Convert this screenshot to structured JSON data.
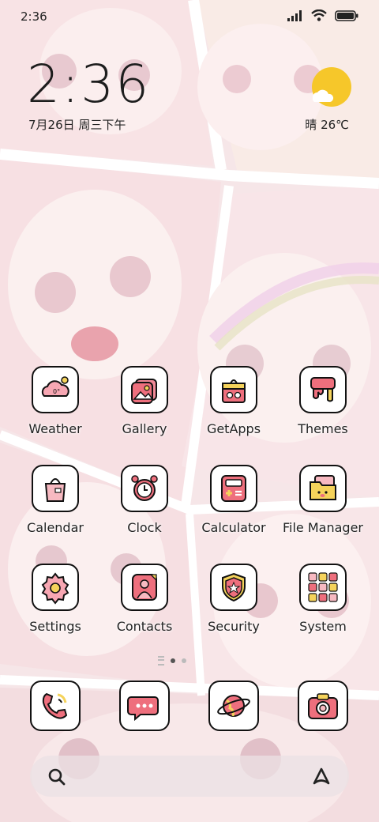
{
  "status_bar": {
    "time": "2:36"
  },
  "clock_widget": {
    "time": "2:36",
    "date": "7月26日 周三下午"
  },
  "weather_widget": {
    "condition": "晴",
    "temperature": "26℃",
    "icon": "sun-cloud-icon"
  },
  "apps": [
    {
      "label": "Weather",
      "icon": "cloud-icon"
    },
    {
      "label": "Gallery",
      "icon": "photo-icon"
    },
    {
      "label": "GetApps",
      "icon": "store-icon"
    },
    {
      "label": "Themes",
      "icon": "paint-bucket-icon"
    },
    {
      "label": "Calendar",
      "icon": "calendar-bag-icon"
    },
    {
      "label": "Clock",
      "icon": "alarm-clock-icon"
    },
    {
      "label": "Calculator",
      "icon": "calculator-icon"
    },
    {
      "label": "File Manager",
      "icon": "folder-icon"
    },
    {
      "label": "Settings",
      "icon": "gear-icon"
    },
    {
      "label": "Contacts",
      "icon": "contact-card-icon"
    },
    {
      "label": "Security",
      "icon": "shield-icon"
    },
    {
      "label": "System",
      "icon": "app-grid-icon"
    }
  ],
  "pager": {
    "pages": 2,
    "current": 1
  },
  "dock": [
    {
      "icon": "phone-icon"
    },
    {
      "icon": "message-icon"
    },
    {
      "icon": "browser-planet-icon"
    },
    {
      "icon": "camera-icon"
    }
  ],
  "colors": {
    "pink": "#ee6f7d",
    "yellow": "#f5d35b",
    "outline": "#111111"
  }
}
